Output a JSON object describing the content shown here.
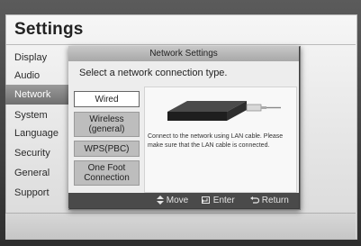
{
  "settings": {
    "title": "Settings",
    "menu": [
      "Display",
      "Audio",
      "Network",
      "System",
      "Language",
      "Security",
      "General",
      "Support"
    ],
    "active_index": 2
  },
  "dialog": {
    "title": "Network Settings",
    "prompt": "Select a network connection type.",
    "options": [
      "Wired",
      "Wireless (general)",
      "WPS(PBC)",
      "One Foot Connection"
    ],
    "selected_index": 0,
    "description": "Connect to the network using LAN cable. Please make sure that the LAN cable is connected."
  },
  "footer": {
    "move": "Move",
    "enter": "Enter",
    "return": "Return"
  },
  "colors": {
    "header_bg": "#b8b8b8",
    "footer_bg": "#4a4a4a",
    "selected_option": "#ffffff",
    "option_bg": "#bdbdbd"
  },
  "icons": [
    "updown-arrow-icon",
    "enter-icon",
    "return-icon",
    "blu-ray-player-icon",
    "lan-cable-icon"
  ]
}
